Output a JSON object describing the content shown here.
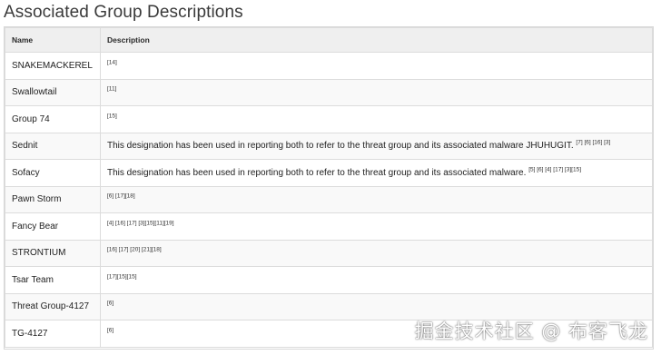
{
  "page": {
    "title": "Associated Group Descriptions"
  },
  "table": {
    "headers": [
      "Name",
      "Description"
    ],
    "rows": [
      {
        "name": "SNAKEMACKEREL",
        "description": "",
        "refs": "[14]"
      },
      {
        "name": "Swallowtail",
        "description": "",
        "refs": "[11]"
      },
      {
        "name": "Group 74",
        "description": "",
        "refs": "[15]"
      },
      {
        "name": "Sednit",
        "description": "This designation has been used in reporting both to refer to the threat group and its associated malware JHUHUGIT.",
        "refs": "[7] [6] [16] [3]"
      },
      {
        "name": "Sofacy",
        "description": "This designation has been used in reporting both to refer to the threat group and its associated malware.",
        "refs": "[5] [6] [4] [17] [3][15]"
      },
      {
        "name": "Pawn Storm",
        "description": "",
        "refs": "[6] [17][18]"
      },
      {
        "name": "Fancy Bear",
        "description": "",
        "refs": "[4] [16] [17] [3][15][11][19]"
      },
      {
        "name": "STRONTIUM",
        "description": "",
        "refs": "[16] [17] [20] [21][18]"
      },
      {
        "name": "Tsar Team",
        "description": "",
        "refs": "[17][15][15]"
      },
      {
        "name": "Threat Group-4127",
        "description": "",
        "refs": "[6]"
      },
      {
        "name": "TG-4127",
        "description": "",
        "refs": "[6]"
      }
    ]
  },
  "watermark": {
    "text": "掘金技术社区 @ 布客飞龙"
  }
}
